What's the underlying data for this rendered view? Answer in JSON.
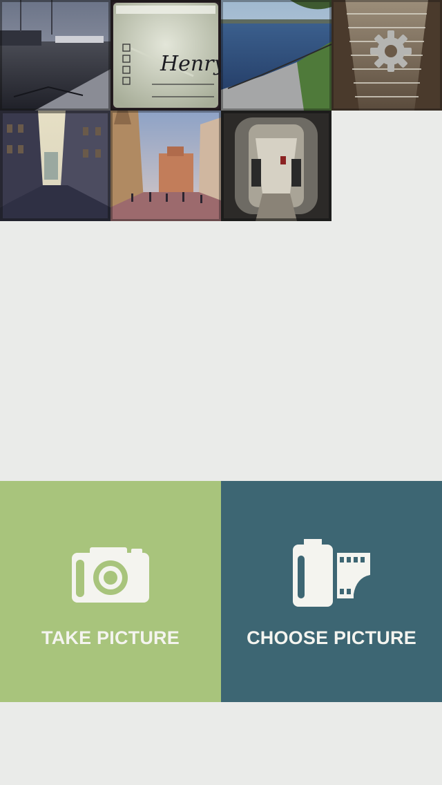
{
  "photos": [
    {
      "icon": "airport-tarmac-photo"
    },
    {
      "icon": "cup-henry-photo",
      "text": "Henry"
    },
    {
      "icon": "lakeside-promenade-photo"
    },
    {
      "icon": "escalator-photo"
    },
    {
      "icon": "city-street-photo"
    },
    {
      "icon": "cathedral-square-photo"
    },
    {
      "icon": "tram-interior-photo"
    }
  ],
  "settings": {
    "icon": "gear-icon"
  },
  "actions": {
    "take": {
      "label": "TAKE PICTURE",
      "icon": "camera-icon",
      "color": "#a8c47c"
    },
    "choose": {
      "label": "CHOOSE PICTURE",
      "icon": "film-roll-icon",
      "color": "#3d6673"
    }
  },
  "colors": {
    "background": "#eaebe9",
    "icon_fill": "#f4f4ef"
  }
}
